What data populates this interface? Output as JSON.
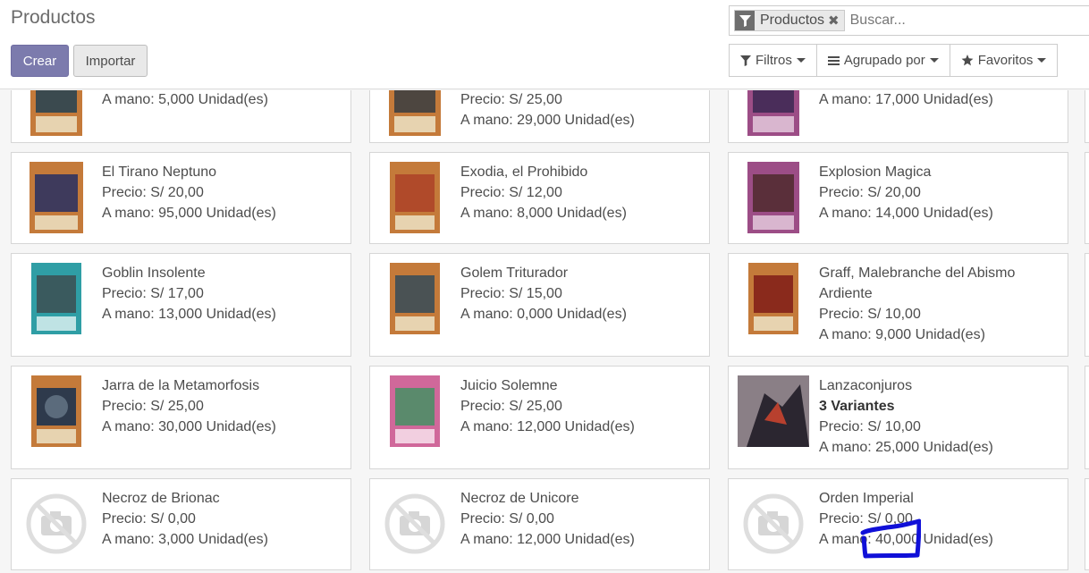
{
  "header": {
    "title": "Productos",
    "create_label": "Crear",
    "import_label": "Importar"
  },
  "search": {
    "facet_label": "Productos",
    "facet_remove": "✖",
    "placeholder": "Buscar..."
  },
  "filters": {
    "filters_label": "Filtros",
    "group_label": "Agrupado por",
    "favorites_label": "Favoritos"
  },
  "products": [
    {
      "name": "",
      "price": "",
      "stock": "A mano: 5,000 Unidad(es)",
      "image": "card-orange"
    },
    {
      "name": "",
      "price": "Precio: S/ 25,00",
      "stock": "A mano: 29,000 Unidad(es)",
      "image": "card-orange"
    },
    {
      "name": "",
      "price": "",
      "stock": "A mano: 17,000 Unidad(es)",
      "image": "card-purple"
    },
    {
      "name": "El Tirano Neptuno",
      "price": "Precio: S/ 20,00",
      "stock": "A mano: 95,000 Unidad(es)",
      "image": "card-orange"
    },
    {
      "name": "Exodia, el Prohibido",
      "price": "Precio: S/ 12,00",
      "stock": "A mano: 8,000 Unidad(es)",
      "image": "card-orange"
    },
    {
      "name": "Explosion Magica",
      "price": "Precio: S/ 20,00",
      "stock": "A mano: 14,000 Unidad(es)",
      "image": "card-purple"
    },
    {
      "name": "Goblin Insolente",
      "price": "Precio: S/ 17,00",
      "stock": "A mano: 13,000 Unidad(es)",
      "image": "card-teal"
    },
    {
      "name": "Golem Triturador",
      "price": "Precio: S/ 15,00",
      "stock": "A mano: 0,000 Unidad(es)",
      "image": "card-orange"
    },
    {
      "name": "Graff, Malebranche del Abismo Ardiente",
      "price": "Precio: S/ 10,00",
      "stock": "A mano: 9,000 Unidad(es)",
      "image": "card-orange"
    },
    {
      "name": "Jarra de la Metamorfosis",
      "price": "Precio: S/ 25,00",
      "stock": "A mano: 30,000 Unidad(es)",
      "image": "card-orange"
    },
    {
      "name": "Juicio Solemne",
      "price": "Precio: S/ 25,00",
      "stock": "A mano: 12,000 Unidad(es)",
      "image": "card-pink"
    },
    {
      "name": "Lanzaconjuros",
      "variants": "3 Variantes",
      "price": "Precio: S/ 10,00",
      "stock": "A mano: 25,000 Unidad(es)",
      "image": "artwork-dark"
    },
    {
      "name": "Necroz de Brionac",
      "price": "Precio: S/ 0,00",
      "stock": "A mano: 3,000 Unidad(es)",
      "image": "no-image-icon"
    },
    {
      "name": "Necroz de Unicore",
      "price": "Precio: S/ 0,00",
      "stock": "A mano: 12,000 Unidad(es)",
      "image": "no-image-icon"
    },
    {
      "name": "Orden Imperial",
      "price": "Precio: S/ 0,00",
      "stock": "A mano: 40,000 Unidad(es)",
      "image": "no-image-icon"
    }
  ],
  "colors": {
    "primary": "#7c7bad",
    "card_orange": "#c47a3a",
    "card_purple": "#9c4d86",
    "card_teal": "#2f9ea5",
    "card_pink": "#d0689a",
    "annotation": "#1010d8"
  }
}
